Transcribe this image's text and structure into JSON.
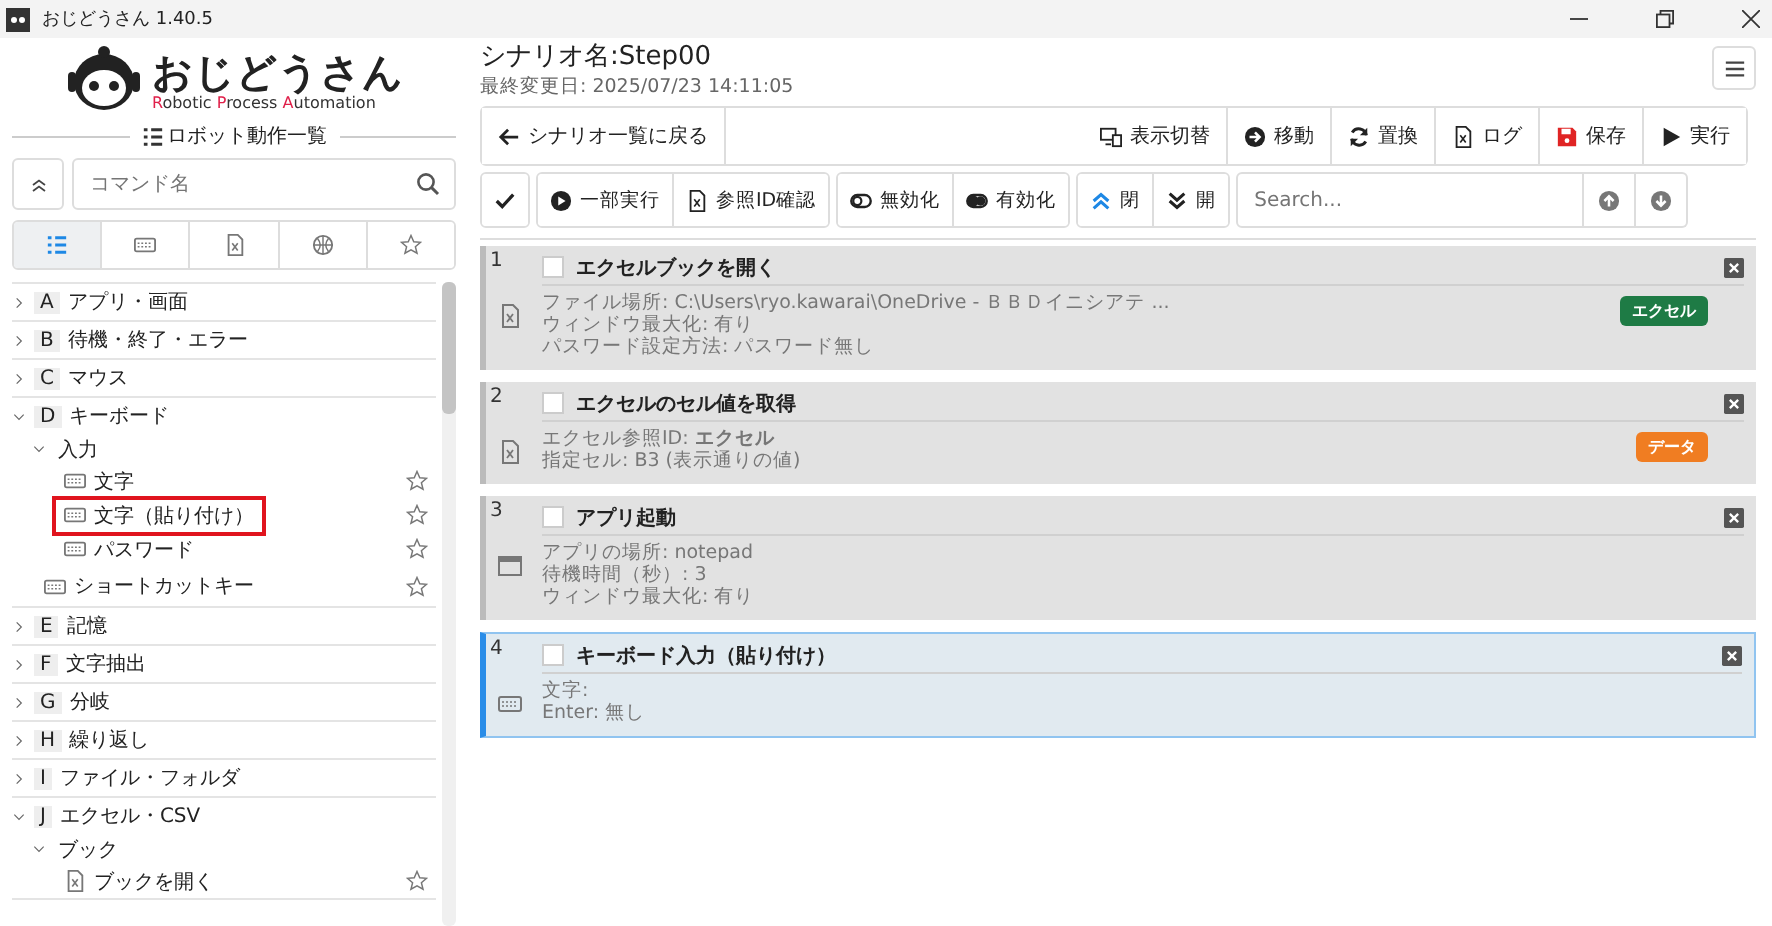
{
  "window": {
    "title": "おじどうさん 1.40.5"
  },
  "logo": {
    "name": "おじどうさん",
    "tagline": "Robotic Process Automation"
  },
  "sidebar": {
    "title": "ロボット動作一覧",
    "search": {
      "placeholder": "コマンド名"
    },
    "tabs": [
      {
        "kind": "list",
        "selected": true
      },
      {
        "kind": "keyboard",
        "selected": false
      },
      {
        "kind": "file",
        "selected": false
      },
      {
        "kind": "globe",
        "selected": false
      },
      {
        "kind": "star",
        "selected": false
      }
    ],
    "tree": [
      {
        "letter": "A",
        "label": "アプリ・画面",
        "expanded": false
      },
      {
        "letter": "B",
        "label": "待機・終了・エラー",
        "expanded": false
      },
      {
        "letter": "C",
        "label": "マウス",
        "expanded": false
      },
      {
        "letter": "D",
        "label": "キーボード",
        "expanded": true,
        "children": [
          {
            "kind": "group",
            "label": "入力",
            "expanded": true,
            "children": [
              {
                "kind": "command",
                "label": "文字",
                "favorite": false,
                "highlighted": false
              },
              {
                "kind": "command",
                "label": "文字（貼り付け）",
                "favorite": false,
                "highlighted": true
              },
              {
                "kind": "command",
                "label": "パスワード",
                "favorite": false,
                "highlighted": false
              }
            ]
          },
          {
            "kind": "command",
            "label": "ショートカットキー",
            "favorite": false,
            "highlighted": false
          }
        ]
      },
      {
        "letter": "E",
        "label": "記憶",
        "expanded": false
      },
      {
        "letter": "F",
        "label": "文字抽出",
        "expanded": false
      },
      {
        "letter": "G",
        "label": "分岐",
        "expanded": false
      },
      {
        "letter": "H",
        "label": "繰り返し",
        "expanded": false
      },
      {
        "letter": "I",
        "label": "ファイル・フォルダ",
        "expanded": false
      },
      {
        "letter": "J",
        "label": "エクセル・CSV",
        "expanded": true,
        "children": [
          {
            "kind": "group",
            "label": "ブック",
            "expanded": true,
            "children": [
              {
                "kind": "command",
                "label": "ブックを開く",
                "favorite": false,
                "highlighted": false
              }
            ]
          }
        ]
      }
    ]
  },
  "scenario": {
    "name": "シナリオ名:Step00",
    "last_modified": "最終変更日: 2025/07/23 14:11:05"
  },
  "toolbar": {
    "back": "シナリオ一覧に戻る",
    "buttons": [
      "表示切替",
      "移動",
      "置換",
      "ログ",
      "保存",
      "実行"
    ]
  },
  "toolbar2": {
    "groups": [
      [
        {
          "kind": "icon"
        }
      ],
      [
        {
          "kind": "text",
          "label": "一部実行"
        },
        {
          "kind": "text",
          "label": "参照ID確認"
        }
      ],
      [
        {
          "kind": "text",
          "label": "無効化"
        },
        {
          "kind": "text",
          "label": "有効化"
        }
      ],
      [
        {
          "kind": "text",
          "label": "閉"
        },
        {
          "kind": "text",
          "label": "開"
        }
      ]
    ],
    "search": {
      "placeholder": "Search..."
    }
  },
  "steps": [
    {
      "number": "1",
      "title": "エクセルブックを開く",
      "checked": false,
      "selected": false,
      "details": [
        "ファイル場所: C:\\Users\\ryo.kawarai\\OneDrive - ＢＢＤイニシアテ ...",
        "ウィンドウ最大化: 有り",
        "パスワード設定方法: パスワード無し"
      ],
      "tag": {
        "label": "エクセル",
        "color": "#1e7b45"
      }
    },
    {
      "number": "2",
      "title": "エクセルのセル値を取得",
      "checked": false,
      "selected": false,
      "details": [
        "エクセル参照ID: **エクセル**",
        "指定セル: B3 (表示通りの値)"
      ],
      "tag": {
        "label": "データ",
        "color": "#f07d22"
      }
    },
    {
      "number": "3",
      "title": "アプリ起動",
      "checked": false,
      "selected": false,
      "details": [
        "アプリの場所: notepad",
        "待機時間（秒）: 3",
        "ウィンドウ最大化: 有り"
      ]
    },
    {
      "number": "4",
      "title": "キーボード入力（貼り付け）",
      "checked": false,
      "selected": true,
      "details": [
        "文字:",
        "Enter: 無し"
      ]
    }
  ]
}
